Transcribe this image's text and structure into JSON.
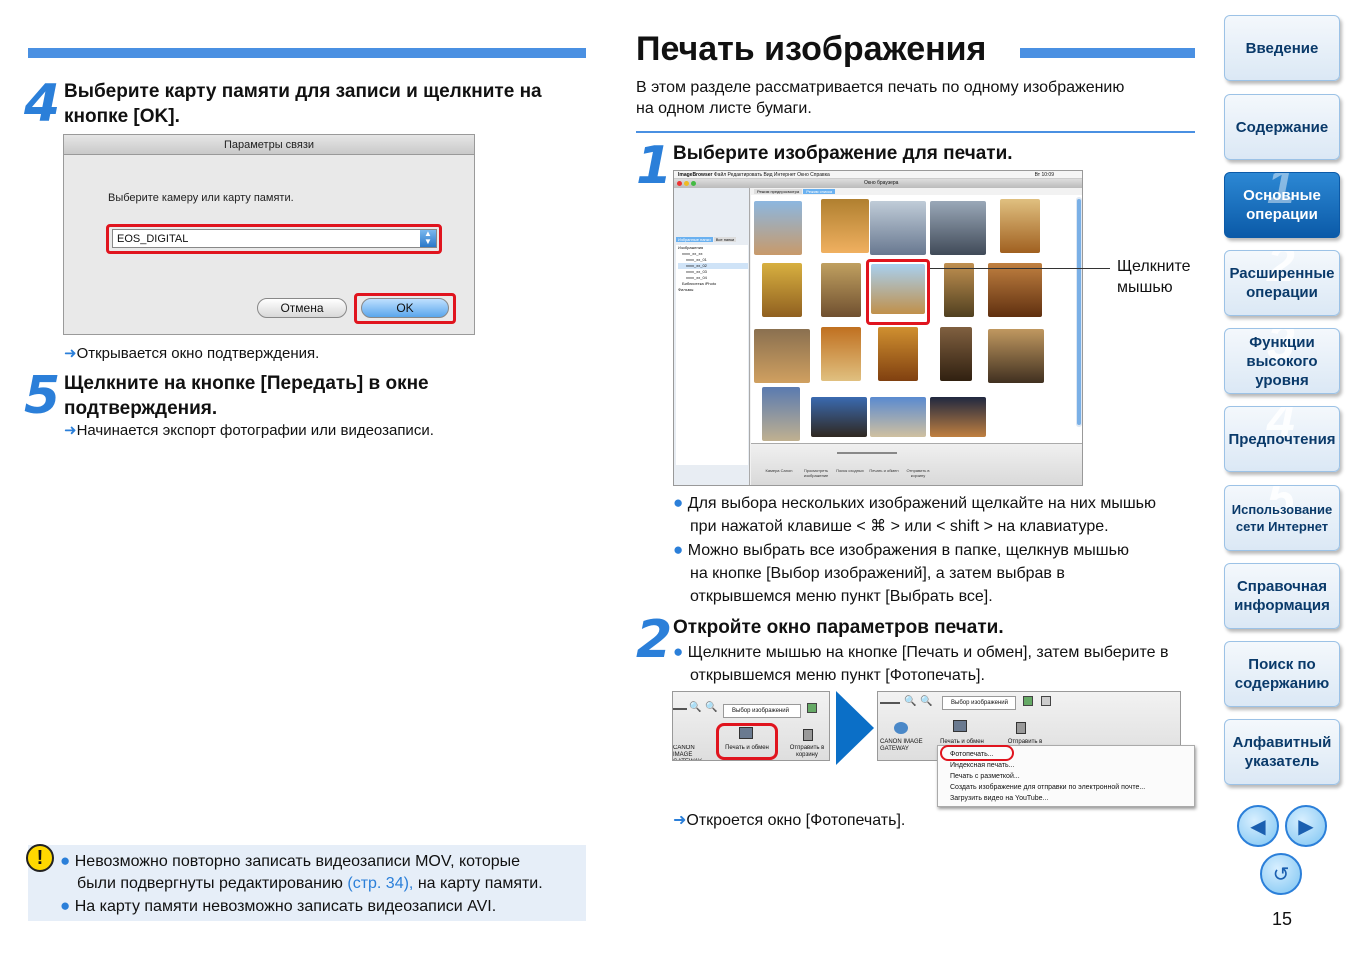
{
  "left": {
    "step4": {
      "num": "4",
      "title_line1": "Выберите карту памяти для записи и щелкните на",
      "title_line2": "кнопке [OK]."
    },
    "dialog": {
      "title": "Параметры связи",
      "prompt": "Выберите камеру или карту памяти.",
      "selected": "EOS_DIGITAL",
      "cancel": "Отмена",
      "ok": "OK"
    },
    "result4": "Открывается окно подтверждения.",
    "step5": {
      "num": "5",
      "title_line1": "Щелкните на кнопке [Передать] в окне",
      "title_line2": "подтверждения."
    },
    "result5": "Начинается экспорт фотографии или видеозаписи.",
    "caution": {
      "line1": "Невозможно повторно записать видеозаписи MOV, которые",
      "line2a": "были подвергнуты редактированию ",
      "link": "(стр. 34),",
      "line2b": " на карту памяти.",
      "line3": "На карту памяти невозможно записать видеозаписи AVI."
    }
  },
  "main": {
    "title": "Печать изображения",
    "intro_line1": "В этом разделе рассматривается печать по одному изображению",
    "intro_line2": "на одном листе бумаги.",
    "step1": {
      "num": "1",
      "title": "Выберите изображение для печати.",
      "callout_line1": "Щелкните",
      "callout_line2": "мышью",
      "bullet1_line1": "Для выбора нескольких изображений щелкайте на них мышью",
      "bullet1_line2": "при нажатой клавише < ⌘ > или < shift > на клавиатуре.",
      "bullet2_line1": "Можно выбрать все изображения в папке, щелкнув мышью",
      "bullet2_line2": "на кнопке [Выбор изображений], а затем выбрав в",
      "bullet2_line3": "открывшемся меню пункт [Выбрать все]."
    },
    "step2": {
      "num": "2",
      "title": "Откройте окно параметров печати.",
      "bullet_line1": "Щелкните мышью на кнопке [Печать и обмен], затем выберите в",
      "bullet_line2": "открывшемся меню пункт [Фотопечать].",
      "result": "Откроется окно [Фотопечать]."
    },
    "browser": {
      "app": "ImageBrowser",
      "menus": [
        "Файл",
        "Редактировать",
        "Вид",
        "Интернет",
        "Окно",
        "Справка"
      ],
      "clock": "Вт 10:09",
      "window_title": "Окно браузера",
      "tabs": [
        "Режим предпросмотра",
        "Режим списка"
      ],
      "side_tabs": [
        "Избранные папки",
        "Все папки"
      ],
      "tree": [
        "Изображения",
        "xxxx_xx_xx",
        "xxxx_xx_01",
        "xxxx_xx_02",
        "xxxx_xx_03",
        "xxxx_xx_04",
        "Библиотека iPhoto",
        "Фильмы"
      ],
      "thumbs": [
        "IMG_0001.JPG",
        "IMG_0002.JPG",
        "IMG_0003.JPG",
        "IMG_0004.JPG",
        "IMG_0005.JPG",
        "IMG_0006.JPG",
        "IMG_0007.JPG",
        "IMG_0008.JPG",
        "IMG_0009.JPG",
        "IMG_0010.JPG",
        "IMG_0011.JPG",
        "IMG_0012.JPG",
        "IMG_0013.JPG",
        "IMG_0014.JPG",
        "IMG_0015.JPG"
      ],
      "toolbar": [
        "Камера Canon",
        "Просмотреть изображение",
        "Поиск сходных",
        "Печать и обмен",
        "Отправить в корзину"
      ]
    },
    "toolbar_left": {
      "select": "Выбор изображений",
      "gateway": "CANON IMAGE GATEWAY",
      "print": "Печать и обмен",
      "trash": "Отправить в корзину"
    },
    "toolbar_right": {
      "select": "Выбор изображений",
      "gateway": "CANON IMAGE GATEWAY",
      "print": "Печать и обмен",
      "trash": "Отправить в корзину",
      "menu": [
        "Фотопечать...",
        "Индексная печать...",
        "Печать с разметкой...",
        "Создать изображение для отправки по электронной почте...",
        "Загрузить видео на YouTube..."
      ]
    }
  },
  "nav": {
    "items": [
      {
        "label": "Введение",
        "num": ""
      },
      {
        "label": "Содержание",
        "num": ""
      },
      {
        "label": "Основные операции",
        "num": "1"
      },
      {
        "label": "Расширенные операции",
        "num": "2"
      },
      {
        "label": "Функции высокого уровня",
        "num": "3"
      },
      {
        "label": "Предпочтения",
        "num": "4"
      },
      {
        "label": "Использование сети Интернет",
        "num": "5"
      },
      {
        "label": "Справочная информация",
        "num": ""
      },
      {
        "label": "Поиск по содержанию",
        "num": ""
      },
      {
        "label": "Алфавитный указатель",
        "num": ""
      }
    ],
    "page_number": "15"
  },
  "colors": {
    "accent": "#2b7fd9",
    "nav_active": "#0b5aa8",
    "highlight": "#e0141e"
  }
}
